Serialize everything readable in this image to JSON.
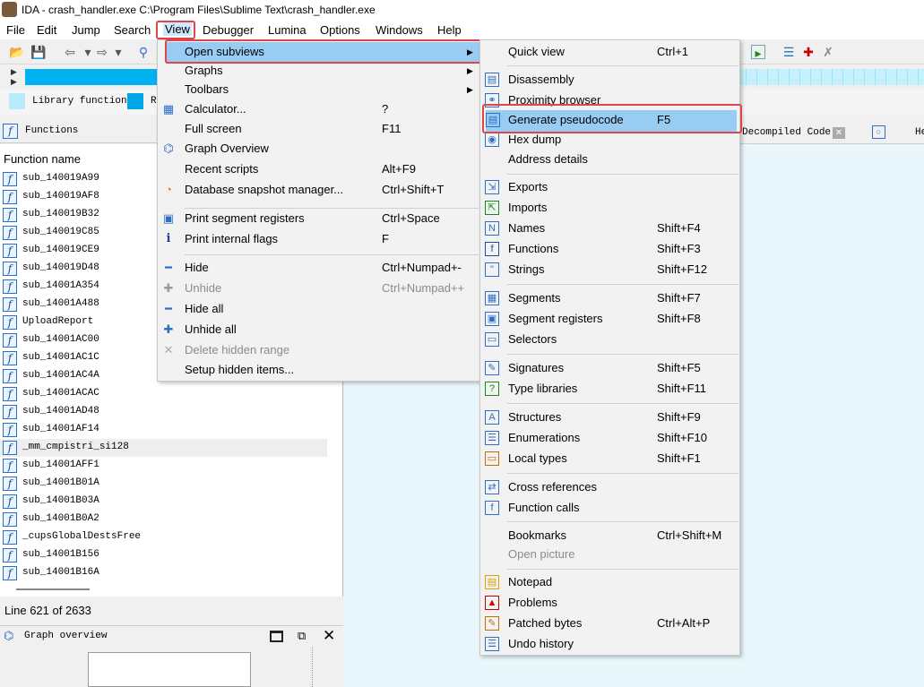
{
  "window": {
    "title": "IDA - crash_handler.exe C:\\Program Files\\Sublime Text\\crash_handler.exe"
  },
  "menubar": [
    {
      "label": "File"
    },
    {
      "label": "Edit"
    },
    {
      "label": "Jump"
    },
    {
      "label": "Search"
    },
    {
      "label": "View"
    },
    {
      "label": "Debugger"
    },
    {
      "label": "Lumina"
    },
    {
      "label": "Options"
    },
    {
      "label": "Windows"
    },
    {
      "label": "Help"
    }
  ],
  "legend": {
    "library_function": "Library function",
    "regular_function_abbrev": "R"
  },
  "functions_panel": {
    "title": "Functions",
    "column_header": "Function name",
    "rows": [
      "sub_140019A99",
      "sub_140019AF8",
      "sub_140019B32",
      "sub_140019C85",
      "sub_140019CE9",
      "sub_140019D48",
      "sub_14001A354",
      "sub_14001A488",
      "UploadReport",
      "sub_14001AC00",
      "sub_14001AC1C",
      "sub_14001AC4A",
      "sub_14001ACAC",
      "sub_14001AD48",
      "sub_14001AF14",
      "_mm_cmpistri_si128",
      "sub_14001AFF1",
      "sub_14001B01A",
      "sub_14001B03A",
      "sub_14001B0A2",
      "_cupsGlobalDestsFree",
      "sub_14001B156",
      "sub_14001B16A"
    ],
    "selected_row": "_mm_cmpistri_si128",
    "status": "Line 621 of 2633"
  },
  "graph_overview": {
    "title": "Graph overview"
  },
  "tabs": {
    "decompiled": "Decompiled Code",
    "next_partial": "He"
  },
  "view_menu": {
    "items": [
      {
        "label": "Open subviews",
        "shortcut": "",
        "submenu": true,
        "icon": "none"
      },
      {
        "label": "Graphs",
        "shortcut": "",
        "submenu": true,
        "icon": "none"
      },
      {
        "label": "Toolbars",
        "shortcut": "",
        "submenu": true,
        "icon": "none"
      },
      {
        "label": "Calculator...",
        "shortcut": "?",
        "icon": "calculator-icon"
      },
      {
        "label": "Full screen",
        "shortcut": "F11",
        "icon": "none"
      },
      {
        "label": "Graph Overview",
        "shortcut": "",
        "icon": "graph-overview-icon"
      },
      {
        "label": "Recent scripts",
        "shortcut": "Alt+F9",
        "icon": "none"
      },
      {
        "label": "Database snapshot manager...",
        "shortcut": "Ctrl+Shift+T",
        "icon": "snapshot-icon"
      },
      {
        "label": "Print segment registers",
        "shortcut": "Ctrl+Space",
        "icon": "segment-registers-icon"
      },
      {
        "label": "Print internal flags",
        "shortcut": "F",
        "icon": "info-icon"
      },
      {
        "label": "Hide",
        "shortcut": "Ctrl+Numpad+-",
        "icon": "minus-icon"
      },
      {
        "label": "Unhide",
        "shortcut": "Ctrl+Numpad++",
        "icon": "plus-icon"
      },
      {
        "label": "Hide all",
        "shortcut": "",
        "icon": "hide-all-icon"
      },
      {
        "label": "Unhide all",
        "shortcut": "",
        "icon": "unhide-all-icon"
      },
      {
        "label": "Delete hidden range",
        "shortcut": "",
        "icon": "delete-icon"
      },
      {
        "label": "Setup hidden items...",
        "shortcut": "",
        "icon": "none"
      }
    ]
  },
  "subviews_menu": {
    "items": [
      {
        "label": "Quick view",
        "shortcut": "Ctrl+1"
      },
      {
        "label": "Disassembly",
        "shortcut": ""
      },
      {
        "label": "Proximity browser",
        "shortcut": ""
      },
      {
        "label": "Generate pseudocode",
        "shortcut": "F5"
      },
      {
        "label": "Hex dump",
        "shortcut": ""
      },
      {
        "label": "Address details",
        "shortcut": ""
      },
      {
        "label": "Exports",
        "shortcut": ""
      },
      {
        "label": "Imports",
        "shortcut": ""
      },
      {
        "label": "Names",
        "shortcut": "Shift+F4"
      },
      {
        "label": "Functions",
        "shortcut": "Shift+F3"
      },
      {
        "label": "Strings",
        "shortcut": "Shift+F12"
      },
      {
        "label": "Segments",
        "shortcut": "Shift+F7"
      },
      {
        "label": "Segment registers",
        "shortcut": "Shift+F8"
      },
      {
        "label": "Selectors",
        "shortcut": ""
      },
      {
        "label": "Signatures",
        "shortcut": "Shift+F5"
      },
      {
        "label": "Type libraries",
        "shortcut": "Shift+F11"
      },
      {
        "label": "Structures",
        "shortcut": "Shift+F9"
      },
      {
        "label": "Enumerations",
        "shortcut": "Shift+F10"
      },
      {
        "label": "Local types",
        "shortcut": "Shift+F1"
      },
      {
        "label": "Cross references",
        "shortcut": ""
      },
      {
        "label": "Function calls",
        "shortcut": ""
      },
      {
        "label": "Bookmarks",
        "shortcut": "Ctrl+Shift+M"
      },
      {
        "label": "Open picture",
        "shortcut": ""
      },
      {
        "label": "Notepad",
        "shortcut": ""
      },
      {
        "label": "Problems",
        "shortcut": ""
      },
      {
        "label": "Patched bytes",
        "shortcut": "Ctrl+Alt+P"
      },
      {
        "label": "Undo history",
        "shortcut": ""
      }
    ]
  },
  "colors": {
    "accent_blue": "#00b3f0",
    "highlight": "#99ccf3",
    "annotation_red": "#e0454b"
  }
}
